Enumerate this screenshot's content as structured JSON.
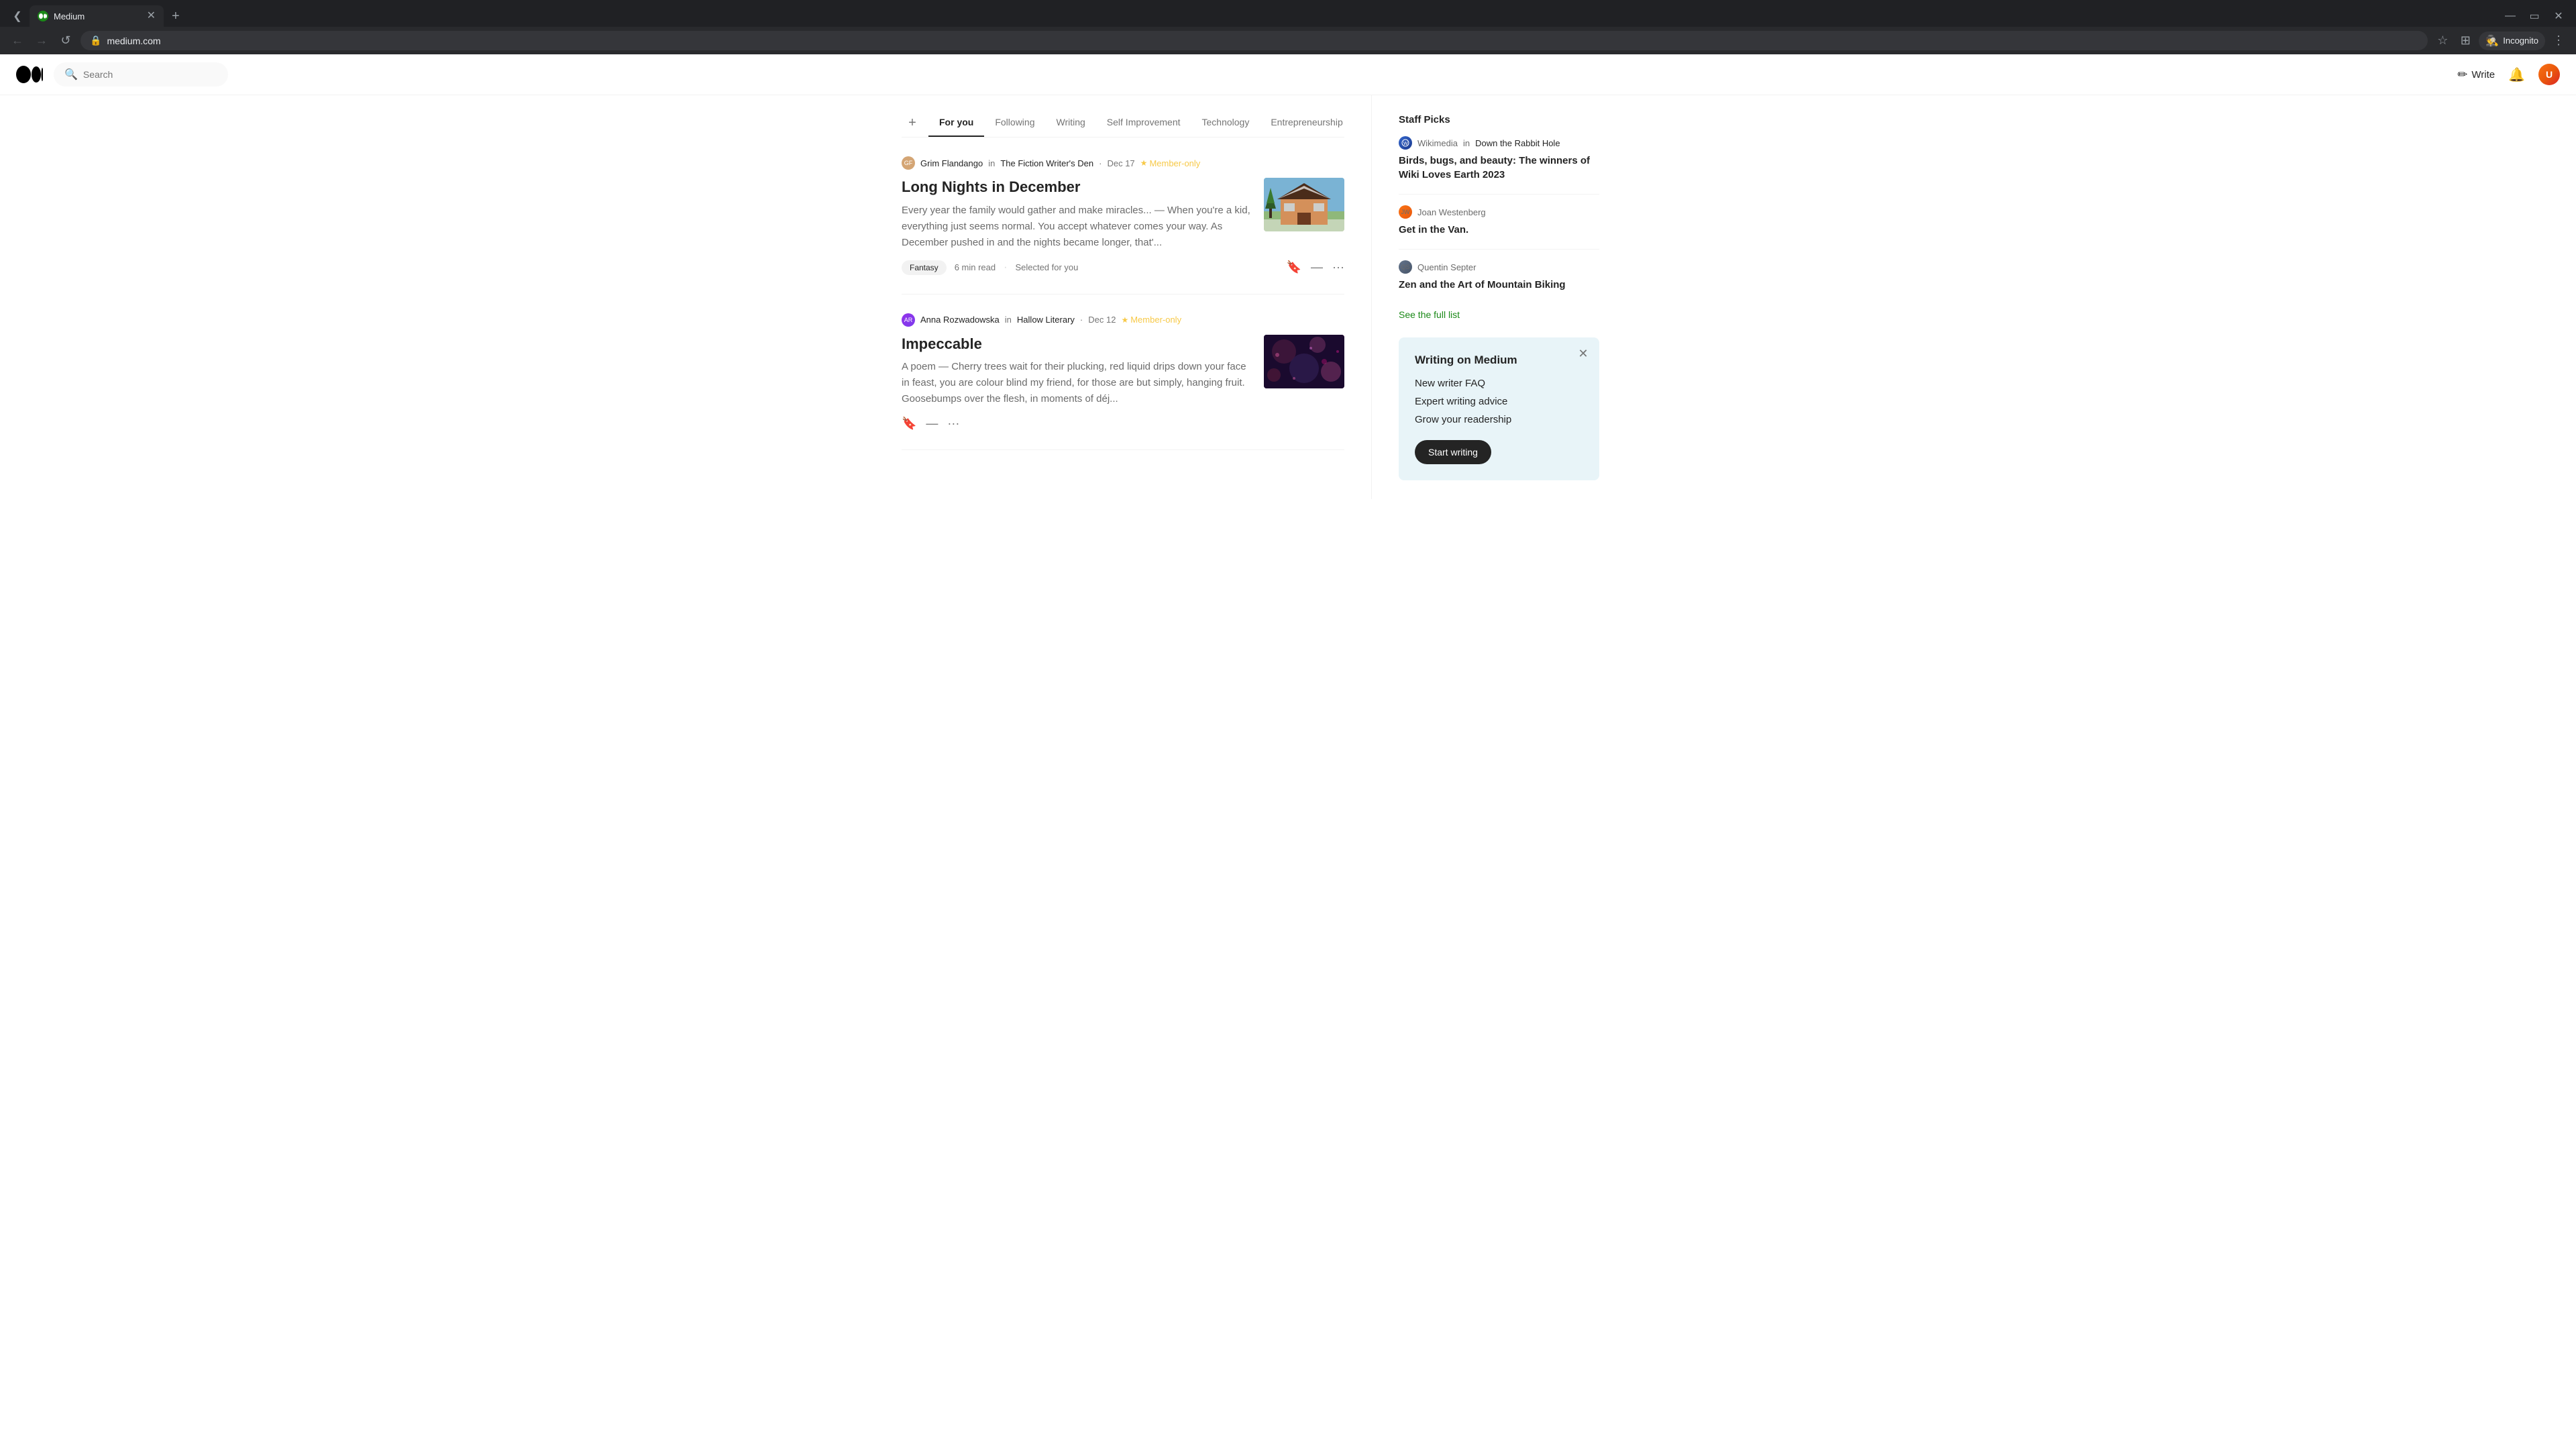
{
  "browser": {
    "tab_favicon_color": "#1a8917",
    "tab_title": "Medium",
    "address": "medium.com",
    "incognito_label": "Incognito"
  },
  "nav": {
    "search_placeholder": "Search",
    "write_label": "Write",
    "logo_alt": "Medium logo"
  },
  "tabs": [
    {
      "id": "add",
      "label": "+",
      "active": false
    },
    {
      "id": "for-you",
      "label": "For you",
      "active": true
    },
    {
      "id": "following",
      "label": "Following",
      "active": false
    },
    {
      "id": "writing",
      "label": "Writing",
      "active": false
    },
    {
      "id": "self-improvement",
      "label": "Self Improvement",
      "active": false
    },
    {
      "id": "technology",
      "label": "Technology",
      "active": false
    },
    {
      "id": "entrepreneurship",
      "label": "Entrepreneurship",
      "active": false
    }
  ],
  "articles": [
    {
      "id": "article-1",
      "author": "Grim Flandango",
      "author_initials": "GF",
      "publication": "The Fiction Writer's Den",
      "date": "Dec 17",
      "member_only": true,
      "member_label": "Member-only",
      "title": "Long Nights in December",
      "excerpt": "Every year the family would gather and make miracles... — When you're a kid, everything just seems normal. You accept whatever comes your way. As December pushed in and the nights became longer, that'...",
      "tag": "Fantasy",
      "read_time": "6 min read",
      "selected_label": "Selected for you",
      "thumb_type": "house"
    },
    {
      "id": "article-2",
      "author": "Anna Rozwadowska",
      "author_initials": "AR",
      "publication": "Hallow Literary",
      "date": "Dec 12",
      "member_only": true,
      "member_label": "Member-only",
      "title": "Impeccable",
      "excerpt": "A poem — Cherry trees wait for their plucking, red liquid drips down your face in feast, you are colour blind my friend, for those are but simply, hanging fruit. Goosebumps over the flesh, in moments of déj...",
      "tag": null,
      "read_time": null,
      "selected_label": null,
      "thumb_type": "dark"
    }
  ],
  "sidebar": {
    "staff_picks_title": "Staff Picks",
    "picks": [
      {
        "id": "pick-1",
        "author": "Wikimedia",
        "author_type": "wiki",
        "in": "in",
        "publication": "Down the Rabbit Hole",
        "title": "Birds, bugs, and beauty: The winners of Wiki Loves Earth 2023"
      },
      {
        "id": "pick-2",
        "author": "Joan Westenberg",
        "author_type": "joan",
        "in": null,
        "publication": null,
        "title": "Get in the Van."
      },
      {
        "id": "pick-3",
        "author": "Quentin Septer",
        "author_type": "quentin",
        "in": null,
        "publication": null,
        "title": "Zen and the Art of Mountain Biking"
      }
    ],
    "see_full_list": "See the full list",
    "writing_card": {
      "title": "Writing on Medium",
      "items": [
        "New writer FAQ",
        "Expert writing advice",
        "Grow your readership"
      ],
      "start_writing": "Start writing"
    }
  }
}
